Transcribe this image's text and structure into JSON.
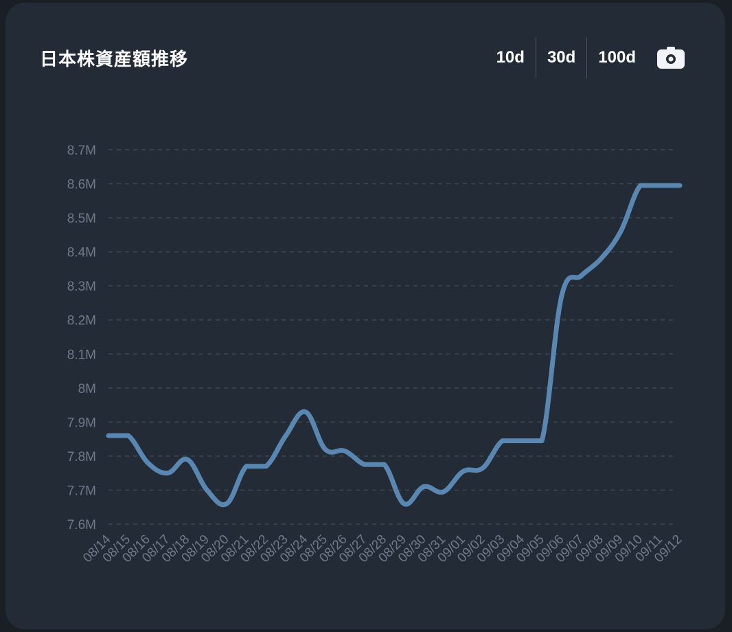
{
  "title": "日本株資産額推移",
  "ranges": [
    "10d",
    "30d",
    "100d"
  ],
  "icons": {
    "snapshot": "camera-icon"
  },
  "colors": {
    "line": "#5a87b2",
    "background": "#232b36",
    "grid": "#3f4856",
    "tick": "#6e7a8a"
  },
  "chart_data": {
    "type": "line",
    "title": "日本株資産額推移",
    "ylim": [
      7.6,
      8.7
    ],
    "yticks": [
      7.6,
      7.7,
      7.8,
      7.9,
      8.0,
      8.1,
      8.2,
      8.3,
      8.4,
      8.5,
      8.6,
      8.7
    ],
    "ytick_labels": [
      "7.6M",
      "7.7M",
      "7.8M",
      "7.9M",
      "8M",
      "8.1M",
      "8.2M",
      "8.3M",
      "8.4M",
      "8.5M",
      "8.6M",
      "8.7M"
    ],
    "grid": true,
    "categories": [
      "08/14",
      "08/15",
      "08/16",
      "08/17",
      "08/18",
      "08/19",
      "08/20",
      "08/21",
      "08/22",
      "08/23",
      "08/24",
      "08/25",
      "08/26",
      "08/27",
      "08/28",
      "08/29",
      "08/30",
      "08/31",
      "09/01",
      "09/02",
      "09/03",
      "09/04",
      "09/05",
      "09/06",
      "09/07",
      "09/08",
      "09/09",
      "09/10",
      "09/11",
      "09/12"
    ],
    "series": [
      {
        "values": [
          7.86,
          7.86,
          7.78,
          7.75,
          7.79,
          7.7,
          7.66,
          7.77,
          7.77,
          7.86,
          7.93,
          7.82,
          7.815,
          7.775,
          7.775,
          7.66,
          7.71,
          7.695,
          7.755,
          7.765,
          7.845,
          7.845,
          7.845,
          8.27,
          8.33,
          8.38,
          8.46,
          8.595,
          8.595,
          8.595
        ]
      }
    ]
  }
}
